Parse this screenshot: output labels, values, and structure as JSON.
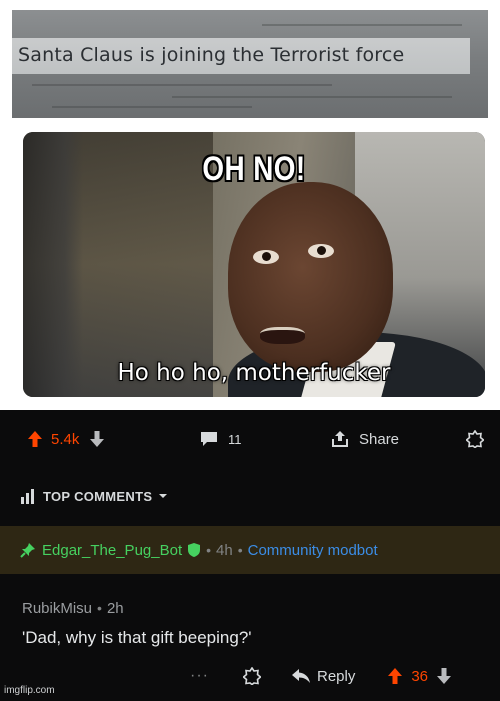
{
  "killfeed": {
    "text": "Santa Claus is joining the Terrorist force"
  },
  "meme": {
    "top_text": "OH NO!",
    "subtitle": "Ho ho ho, motherfucker"
  },
  "post": {
    "score": "5.4k",
    "comments_count": "11",
    "share_label": "Share"
  },
  "sort": {
    "label": "TOP COMMENTS"
  },
  "pinned_comment": {
    "username": "Edgar_The_Pug_Bot",
    "time": "4h",
    "flair": "Community modbot"
  },
  "comment": {
    "username": "RubikMisu",
    "time": "2h",
    "body": "'Dad, why is that gift beeping?'",
    "more": "···",
    "reply_label": "Reply",
    "score": "36"
  },
  "watermark": "imgflip.com",
  "colors": {
    "upvote": "#ff4500",
    "mod_green": "#46d160",
    "flair_blue": "#3b8de6",
    "pinned_bg": "#2e2714",
    "dark_bg": "#0b0b0c"
  },
  "icons": {
    "upvote": "arrow-up-icon",
    "downvote": "arrow-down-icon",
    "comments": "comment-bubble-icon",
    "share": "share-icon",
    "award": "award-icon",
    "sort": "sort-bars-icon",
    "pin": "pin-icon",
    "shield": "shield-icon",
    "reply": "reply-icon"
  }
}
